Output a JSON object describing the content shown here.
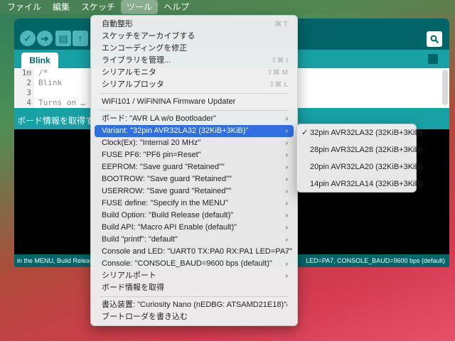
{
  "menubar": {
    "items": [
      {
        "label": "ファイル",
        "active": false
      },
      {
        "label": "編集",
        "active": false
      },
      {
        "label": "スケッチ",
        "active": false
      },
      {
        "label": "ツール",
        "active": true
      },
      {
        "label": "ヘルプ",
        "active": false
      }
    ]
  },
  "ide": {
    "tab_label": "Blink",
    "editor": {
      "line_numbers": [
        "1⊟",
        "2",
        "3",
        "4"
      ],
      "lines": [
        "/*",
        "  Blink",
        "",
        "  Turns on … repeatedly"
      ]
    },
    "status_text": "ボード情報を取得す",
    "footer_left": "in the MENU, Build Releas",
    "footer_right": "LED=PA7, CONSOLE_BAUD=9600 bps (default)"
  },
  "tools_menu": {
    "items": [
      {
        "type": "item",
        "label": "自動整形",
        "shortcut": "⌘ T",
        "dim": false
      },
      {
        "type": "item",
        "label": "スケッチをアーカイブする",
        "dim": false
      },
      {
        "type": "item",
        "label": "エンコーディングを修正",
        "dim": false
      },
      {
        "type": "item",
        "label": "ライブラリを管理...",
        "shortcut": "⇧⌘ I",
        "dim": false
      },
      {
        "type": "item",
        "label": "シリアルモニタ",
        "shortcut": "⇧⌘ M",
        "dim": false
      },
      {
        "type": "item",
        "label": "シリアルプロッタ",
        "shortcut": "⇧⌘ L",
        "dim": false
      },
      {
        "type": "sep"
      },
      {
        "type": "item",
        "label": "WiFi101 / WiFiNINA Firmware Updater",
        "dim": false
      },
      {
        "type": "sep"
      },
      {
        "type": "item",
        "label": "ボード: \"AVR LA w/o Bootloader\"",
        "submenu": true
      },
      {
        "type": "item",
        "label": "Variant: \"32pin AVR32LA32 (32KiB+3KiB)\"",
        "submenu": true,
        "selected": true
      },
      {
        "type": "item",
        "label": "Clock(Ex): \"Internal 20 MHz\"",
        "submenu": true
      },
      {
        "type": "item",
        "label": "FUSE PF6: \"PF6 pin=Reset\"",
        "submenu": true
      },
      {
        "type": "item",
        "label": "EEPROM: \"Save guard \"Retained\"\"",
        "submenu": true
      },
      {
        "type": "item",
        "label": "BOOTROW: \"Save guard \"Retained\"\"",
        "submenu": true
      },
      {
        "type": "item",
        "label": "USERROW: \"Save guard \"Retained\"\"",
        "submenu": true
      },
      {
        "type": "item",
        "label": "FUSE define: \"Specify in the MENU\"",
        "submenu": true
      },
      {
        "type": "item",
        "label": "Build Option: \"Build Release (default)\"",
        "submenu": true
      },
      {
        "type": "item",
        "label": "Build API: \"Macro API Enable (default)\"",
        "submenu": true
      },
      {
        "type": "item",
        "label": "Build \"printf\": \"default\"",
        "submenu": true
      },
      {
        "type": "item",
        "label": "Console and LED: \"UART0 TX:PA0 RX:PA1 LED=PA7\"",
        "submenu": true
      },
      {
        "type": "item",
        "label": "Console: \"CONSOLE_BAUD=9600 bps (default)\"",
        "submenu": true
      },
      {
        "type": "item",
        "label": "シリアルポート",
        "submenu": true
      },
      {
        "type": "item",
        "label": "ボード情報を取得"
      },
      {
        "type": "sep"
      },
      {
        "type": "item",
        "label": "書込装置: \"Curiosity Nano (nEDBG: ATSAMD21E18)\"",
        "submenu": true
      },
      {
        "type": "item",
        "label": "ブートローダを書き込む"
      }
    ]
  },
  "variant_submenu": {
    "items": [
      {
        "label": "32pin AVR32LA32 (32KiB+3KiB)",
        "checked": true
      },
      {
        "label": "28pin AVR32LA28 (32KiB+3KiB)",
        "checked": false
      },
      {
        "label": "20pin AVR32LA20 (32KiB+3KiB)",
        "checked": false
      },
      {
        "label": "14pin AVR32LA14 (32KiB+3KiB)",
        "checked": false
      }
    ]
  }
}
